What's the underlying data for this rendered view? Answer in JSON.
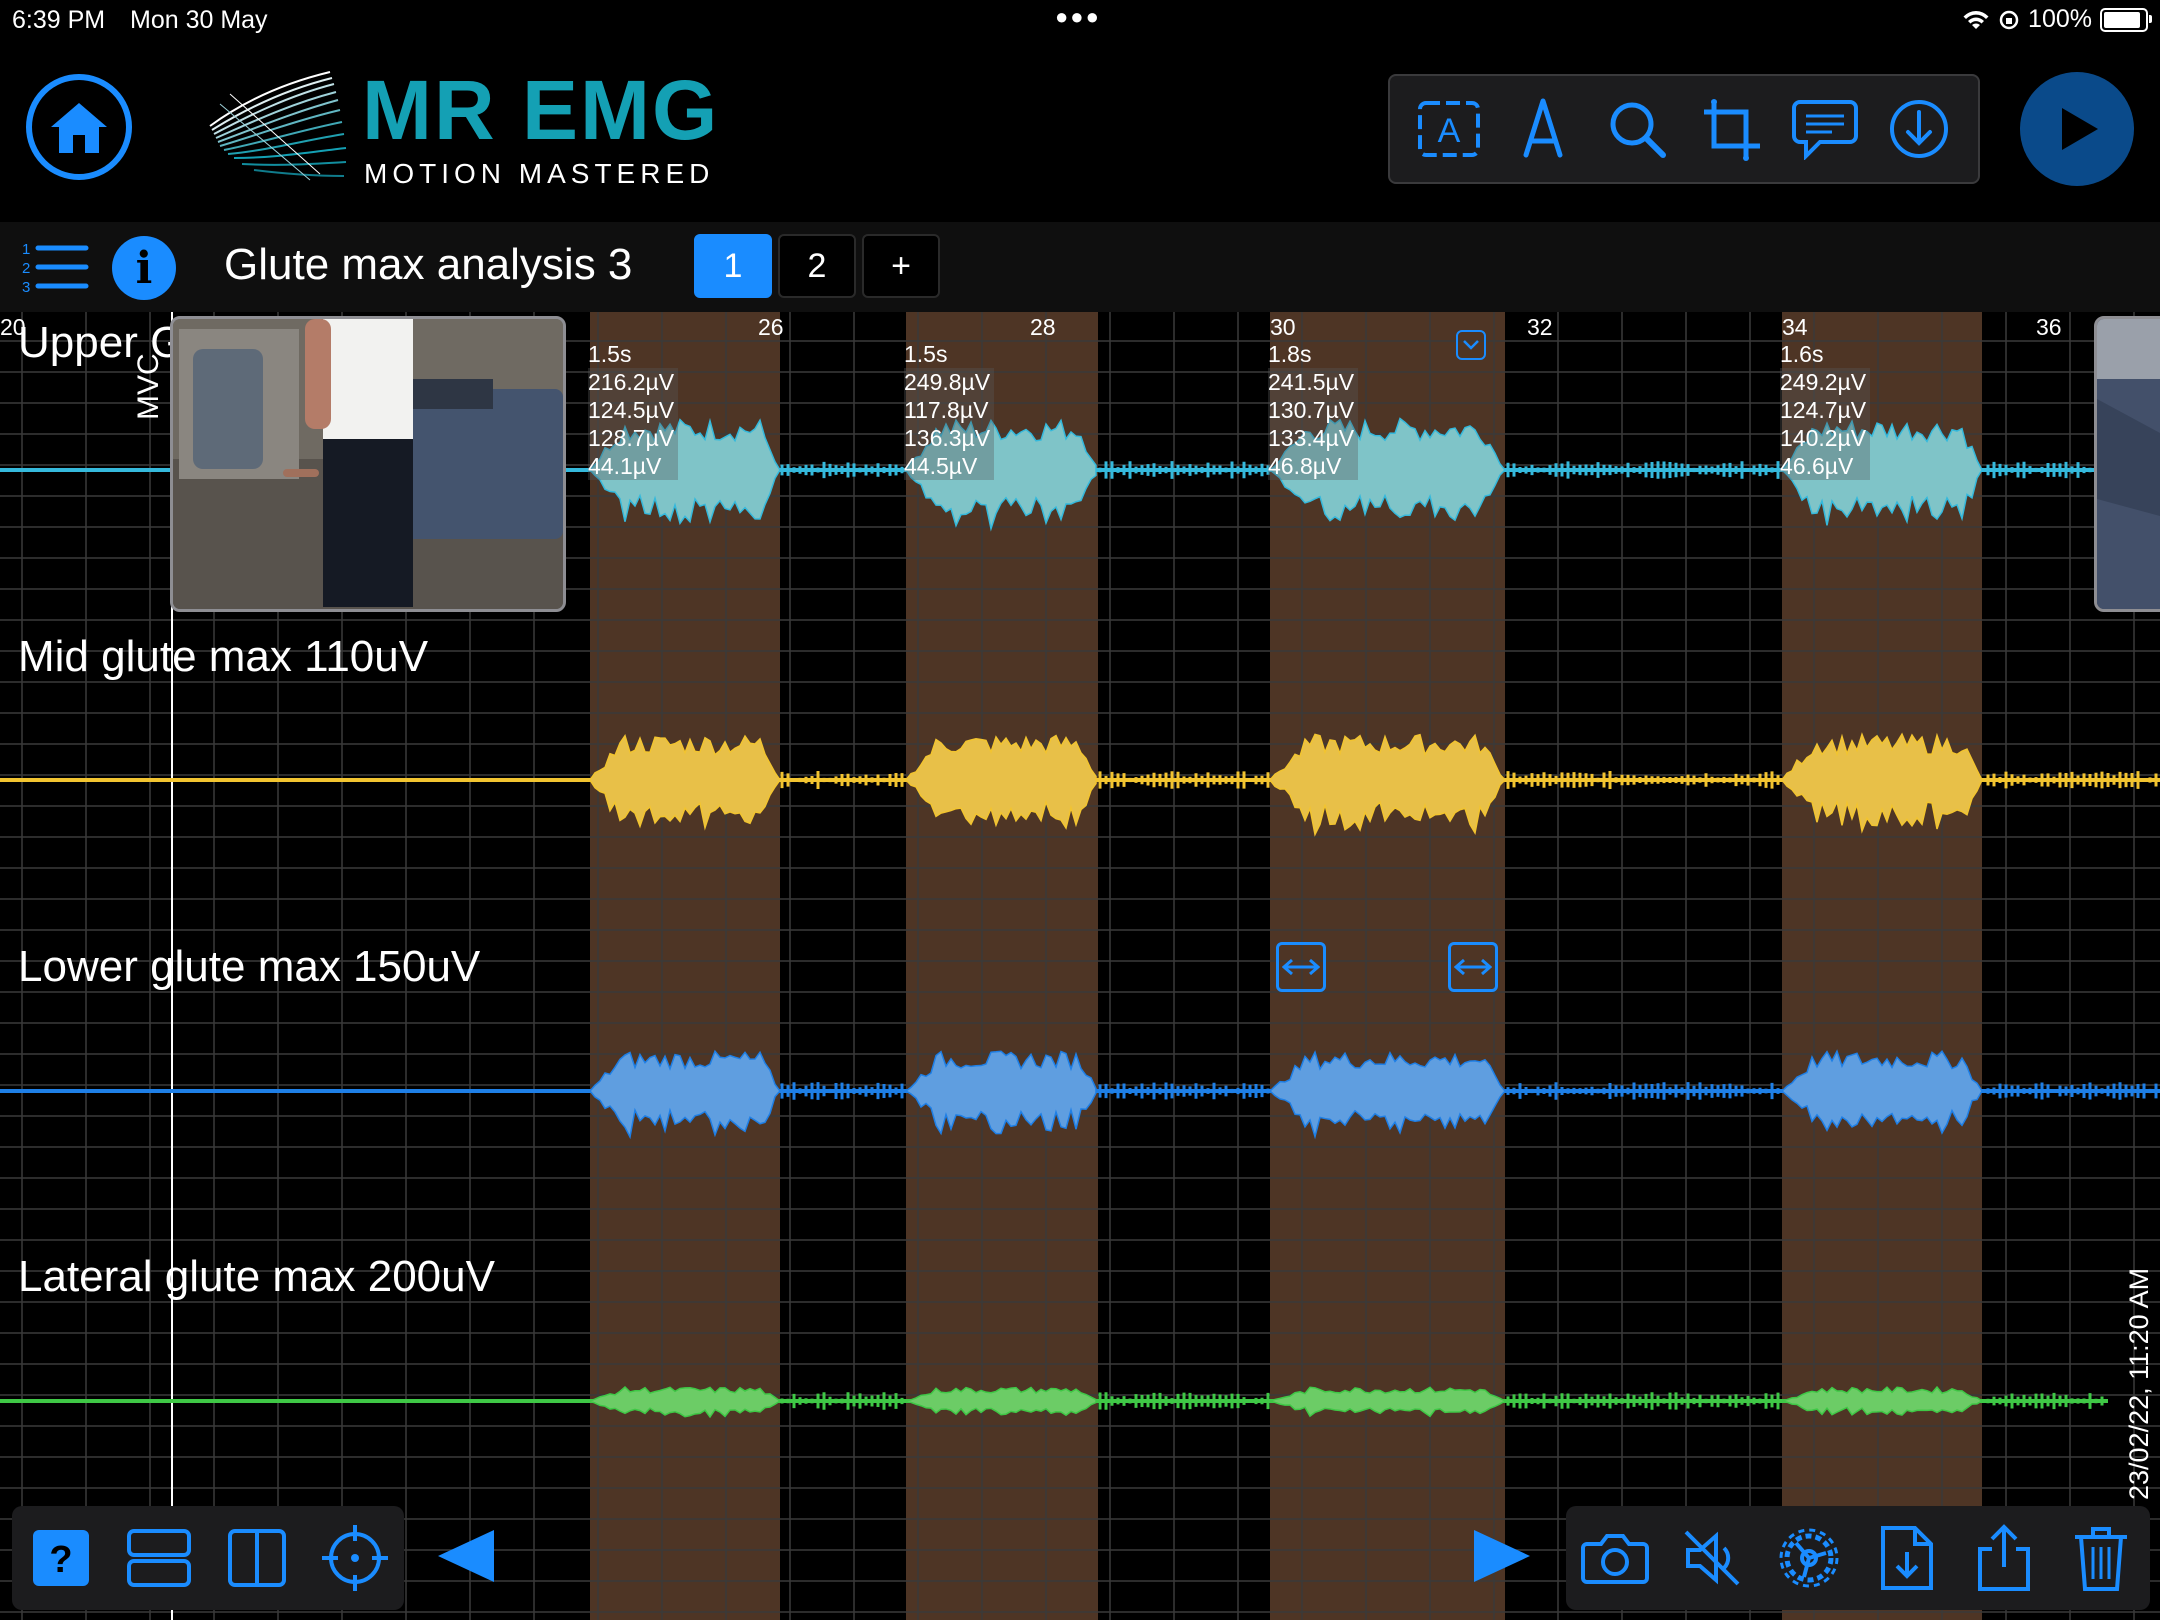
{
  "status_bar": {
    "time": "6:39 PM",
    "date": "Mon 30 May",
    "battery": "100%",
    "battery_level": 1.0
  },
  "header": {
    "logo_title": "MR EMG",
    "logo_subtitle": "MOTION MASTERED",
    "tools": [
      "text-box-icon",
      "pen-icon",
      "zoom-icon",
      "crop-icon",
      "comment-icon",
      "download-icon"
    ],
    "play_icon": "play-icon",
    "home_icon": "home-icon"
  },
  "subbar": {
    "title": "Glute max analysis 3",
    "pages": [
      "1",
      "2",
      "+"
    ],
    "active_page": "1"
  },
  "plot": {
    "mvc_label": "MVC",
    "timestamp": "23/02/22, 11:20 AM",
    "time_ticks": [
      "20",
      "26",
      "28",
      "30",
      "32",
      "34",
      "36"
    ],
    "channels": [
      {
        "label": "Upper Glute max 150uV",
        "color": "#35b9dc",
        "fill": "#7fc4c8"
      },
      {
        "label": "Mid glute max 110uV",
        "color": "#f2c430",
        "fill": "#e8c048"
      },
      {
        "label": "Lower glute max 150uV",
        "color": "#1e7fe6",
        "fill": "#5f9ee0"
      },
      {
        "label": "Lateral glute max 200uV",
        "color": "#3fc846",
        "fill": "#6ccc66"
      }
    ],
    "segments": [
      {
        "duration": "1.5s",
        "v1": "216.2µV",
        "v2": "124.5µV",
        "v3": "128.7µV",
        "v4": "44.1µV"
      },
      {
        "duration": "1.5s",
        "v1": "249.8µV",
        "v2": "117.8µV",
        "v3": "136.3µV",
        "v4": "44.5µV"
      },
      {
        "duration": "1.8s",
        "v1": "241.5µV",
        "v2": "130.7µV",
        "v3": "133.4µV",
        "v4": "46.8µV"
      },
      {
        "duration": "1.6s",
        "v1": "249.2µV",
        "v2": "124.7µV",
        "v3": "140.2µV",
        "v4": "46.6µV"
      }
    ]
  },
  "bottom_left": [
    "help-icon",
    "stacked-view-icon",
    "split-view-icon",
    "target-icon"
  ],
  "bottom_right": [
    "camera-icon",
    "mute-icon",
    "settings-icon",
    "export-file-icon",
    "share-icon",
    "trash-icon"
  ],
  "colors": {
    "accent": "#1a8cff",
    "segment_band": "#4e3525",
    "grid": "#3a3a3a"
  }
}
